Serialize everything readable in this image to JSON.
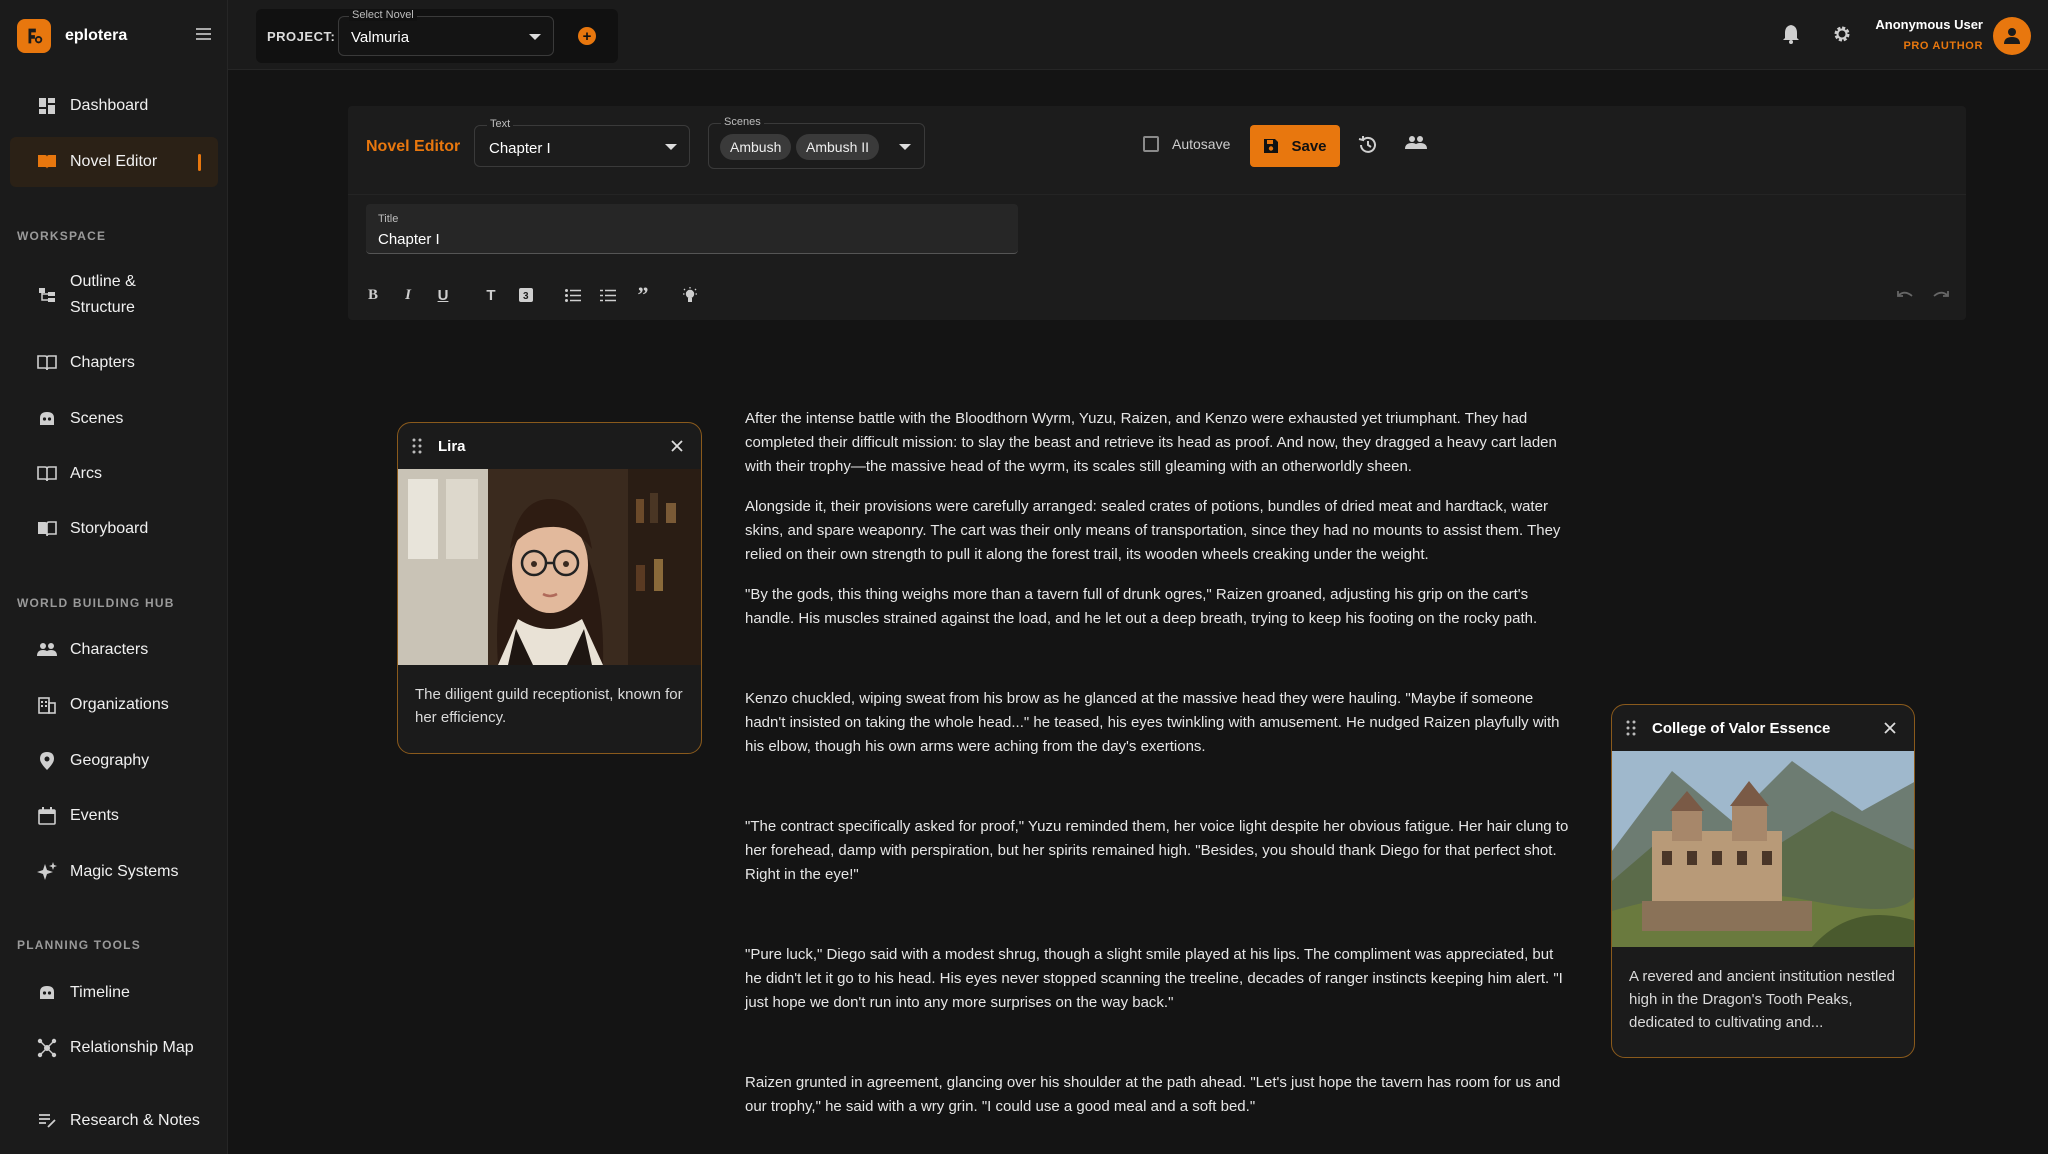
{
  "brand": {
    "name": "eplotera"
  },
  "sidebar": {
    "top_items": [
      {
        "label": "Dashboard",
        "icon": "dashboard-icon"
      },
      {
        "label": "Novel Editor",
        "icon": "book-icon",
        "active": true
      }
    ],
    "sections": [
      {
        "title": "WORKSPACE",
        "items": [
          "Outline & Structure",
          "Chapters",
          "Scenes",
          "Arcs",
          "Storyboard"
        ]
      },
      {
        "title": "WORLD BUILDING HUB",
        "items": [
          "Characters",
          "Organizations",
          "Geography",
          "Events",
          "Magic Systems"
        ]
      },
      {
        "title": "PLANNING TOOLS",
        "items": [
          "Timeline",
          "Relationship Map",
          "Research & Notes"
        ]
      }
    ]
  },
  "topbar": {
    "project_label": "PROJECT:",
    "select_novel_label": "Select Novel",
    "selected_novel": "Valmuria",
    "user_name": "Anonymous User",
    "user_role": "PRO AUTHOR"
  },
  "editor": {
    "label": "Novel Editor",
    "text_field_label": "Text",
    "text_field_value": "Chapter I",
    "scenes_label": "Scenes",
    "scenes": [
      "Ambush",
      "Ambush II"
    ],
    "autosave_label": "Autosave",
    "autosave_checked": false,
    "save_label": "Save",
    "title_label": "Title",
    "title_value": "Chapter I"
  },
  "character_card": {
    "name": "Lira",
    "description": "The diligent guild receptionist, known for her efficiency."
  },
  "location_card": {
    "name": "College of Valor Essence",
    "description": "A revered and ancient institution nestled high in the Dragon's Tooth Peaks, dedicated to cultivating and..."
  },
  "story": {
    "paragraphs": [
      "After the intense battle with the Bloodthorn Wyrm, Yuzu, Raizen, and Kenzo were exhausted yet triumphant. They had completed their difficult mission: to slay the beast and retrieve its head as proof. And now, they dragged a heavy cart laden with their trophy—the massive head of the wyrm, its scales still gleaming with an otherworldly sheen.",
      "Alongside it, their provisions were carefully arranged: sealed crates of potions, bundles of dried meat and hardtack, water skins, and spare weaponry. The cart was their only means of transportation, since they had no mounts to assist them. They relied on their own strength to pull it along the forest trail, its wooden wheels creaking under the weight.",
      "\"By the gods, this thing weighs more than a tavern full of drunk ogres,\" Raizen groaned, adjusting his grip on the cart's handle. His muscles strained against the load, and he let out a deep breath, trying to keep his footing on the rocky path.",
      "Kenzo chuckled, wiping sweat from his brow as he glanced at the massive head they were hauling. \"Maybe if someone hadn't insisted on taking the whole head...\" he teased, his eyes twinkling with amusement. He nudged Raizen playfully with his elbow, though his own arms were aching from the day's exertions.",
      "\"The contract specifically asked for proof,\" Yuzu reminded them, her voice light despite her obvious fatigue. Her hair clung to her forehead, damp with perspiration, but her spirits remained high. \"Besides, you should thank Diego for that perfect shot. Right in the eye!\"",
      "\"Pure luck,\" Diego said with a modest shrug, though a slight smile played at his lips. The compliment was appreciated, but he didn't let it go to his head. His eyes never stopped scanning the treeline, decades of ranger instincts keeping him alert. \"I just hope we don't run into any more surprises on the way back.\"",
      "Raizen grunted in agreement, glancing over his shoulder at the path ahead. \"Let's just hope the tavern has room for us and our trophy,\" he said with a wry grin. \"I could use a good meal and a soft bed.\""
    ]
  },
  "colors": {
    "accent": "#e8770e",
    "background": "#141414",
    "panel": "#1b1b1b"
  }
}
